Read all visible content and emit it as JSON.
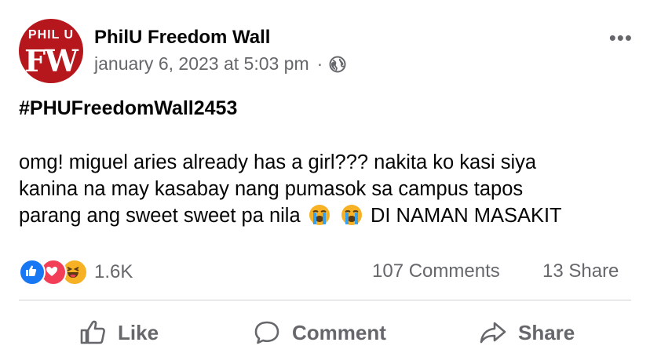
{
  "post": {
    "page_name": "PhilU Freedom Wall",
    "avatar": {
      "top_text": "PHIL U",
      "monogram": "FW",
      "color": "#b5171d"
    },
    "timestamp": "january 6, 2023 at 5:03 pm",
    "separator": "·",
    "privacy_icon": "globe-icon",
    "more_label": "•••",
    "hashtag": "#PHUFreedomWall2453",
    "text_line1": "omg! miguel aries already has a girl??? nakita ko kasi siya",
    "text_line2": "kanina na may kasabay nang pumasok sa campus tapos",
    "text_line3_before": "parang ang sweet sweet pa nila",
    "text_line3_after": "DI NAMAN MASAKIT",
    "inline_emojis": [
      "loudly-crying-emoji",
      "loudly-crying-emoji"
    ]
  },
  "stats": {
    "reactions": [
      "like",
      "love",
      "haha"
    ],
    "reaction_count": "1.6K",
    "comments": "107 Comments",
    "shares": "13 Share"
  },
  "actions": {
    "like": "Like",
    "comment": "Comment",
    "share": "Share"
  },
  "colors": {
    "like_blue": "#1877f2",
    "love_red": "#f33e58",
    "haha_yellow": "#f7b125",
    "muted_text": "#65676b"
  }
}
